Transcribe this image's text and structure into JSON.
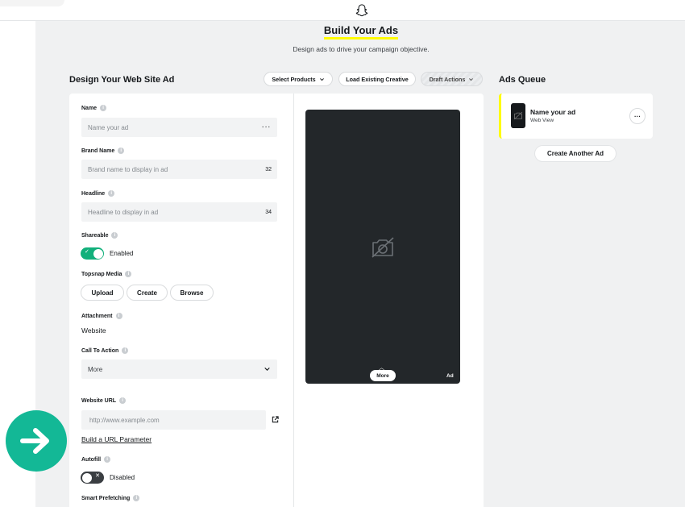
{
  "header": {
    "title": "Build Your Ads",
    "subtitle": "Design ads to drive your campaign objective."
  },
  "design": {
    "title": "Design Your Web Site Ad",
    "select_products": "Select Products",
    "load_existing": "Load Existing Creative",
    "draft_actions": "Draft Actions"
  },
  "form": {
    "name": {
      "label": "Name",
      "placeholder": "Name your ad",
      "more": "···"
    },
    "brand": {
      "label": "Brand Name",
      "placeholder": "Brand name to display in ad",
      "count": "32"
    },
    "headline": {
      "label": "Headline",
      "placeholder": "Headline to display in ad",
      "count": "34"
    },
    "shareable": {
      "label": "Shareable",
      "state": "Enabled"
    },
    "topsnap": {
      "label": "Topsnap Media",
      "upload": "Upload",
      "create": "Create",
      "browse": "Browse"
    },
    "attachment": {
      "label": "Attachment",
      "value": "Website"
    },
    "cta": {
      "label": "Call To Action",
      "value": "More"
    },
    "website_url": {
      "label": "Website URL",
      "placeholder": "http://www.example.com",
      "url_param": "Build a URL Parameter"
    },
    "autofill": {
      "label": "Autofill",
      "state": "Disabled"
    },
    "prefetch": {
      "label": "Smart Prefetching"
    }
  },
  "preview": {
    "more": "More",
    "ad": "Ad"
  },
  "queue": {
    "title": "Ads Queue",
    "item_name": "Name your ad",
    "item_type": "Web View",
    "create_another": "Create Another Ad"
  },
  "colors": {
    "accent": "#fffc00",
    "toggle_on": "#12b07b",
    "fab": "#13b896",
    "preview_bg": "#23272a"
  },
  "icons": [
    "snapchat-ghost-icon",
    "info-icon",
    "chevron-down-icon",
    "external-link-icon",
    "camera-off-icon",
    "arrow-right-icon"
  ]
}
